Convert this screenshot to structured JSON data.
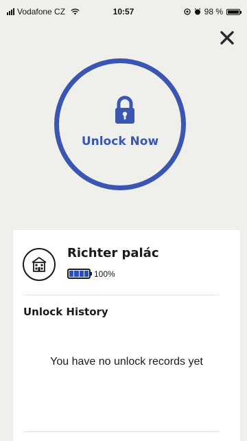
{
  "status_bar": {
    "carrier": "Vodafone CZ",
    "time": "10:57",
    "battery_text": "98 %",
    "battery_level": 0.98
  },
  "header": {
    "close_icon": "close-icon"
  },
  "unlock": {
    "label": "Unlock Now",
    "icon": "lock-icon",
    "accent_color": "#3a56b0"
  },
  "lock": {
    "name": "Richter palác",
    "icon": "building-icon",
    "battery_text": "100%",
    "battery_level": 1.0
  },
  "history": {
    "title": "Unlock History",
    "empty_message": "You have no unlock records yet"
  }
}
